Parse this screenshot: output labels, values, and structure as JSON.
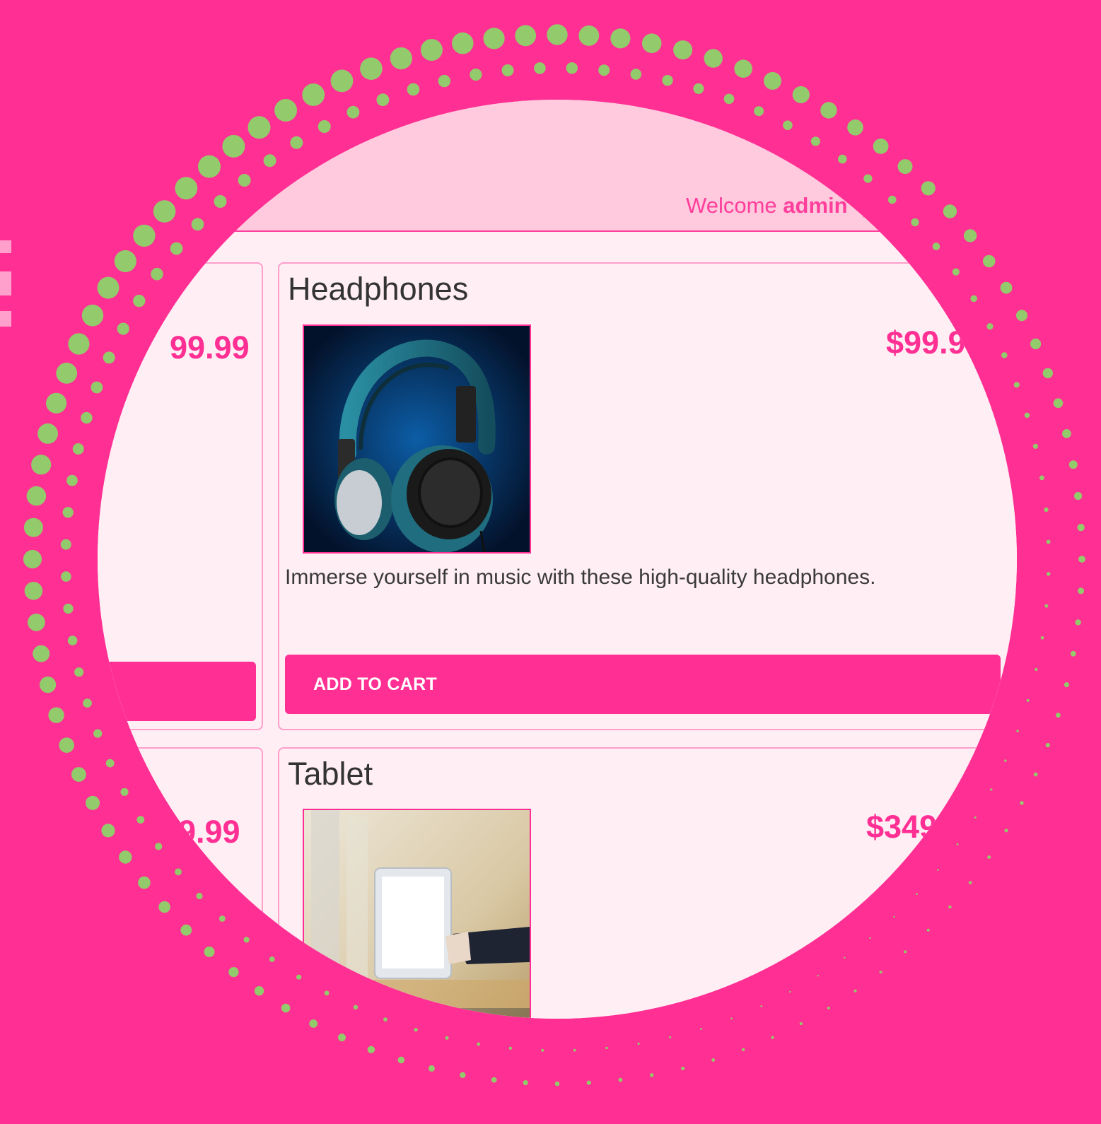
{
  "header": {
    "welcome_prefix": "Welcome",
    "username": "admin",
    "separator": "|"
  },
  "products": [
    {
      "name": "",
      "price": "99.99",
      "description": "",
      "button": ""
    },
    {
      "name": "Headphones",
      "price": "$99.9",
      "description": "Immerse yourself in music with these high-quality headphones.",
      "button": "ADD TO CART",
      "image_icon": "headphones-image"
    },
    {
      "name": "",
      "price": "9.99",
      "description": "",
      "button": ""
    },
    {
      "name": "Tablet",
      "price": "$349",
      "description": "",
      "button": "",
      "image_icon": "tablet-image"
    }
  ],
  "colors": {
    "background": "#FF2F93",
    "dots": "#93CA6B",
    "header_bg": "#FFC9DE",
    "content_bg": "#FFEEF4",
    "accent": "#FF2F93"
  }
}
